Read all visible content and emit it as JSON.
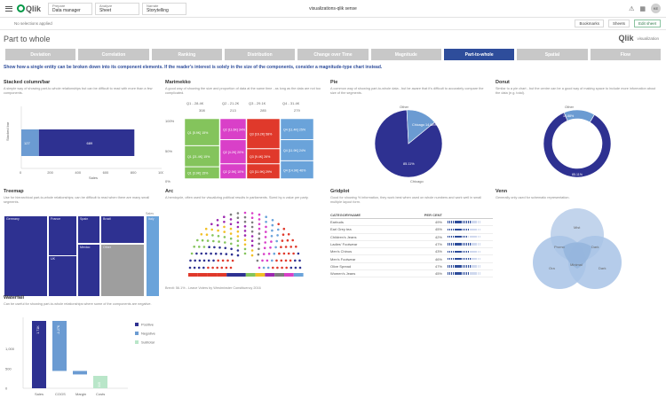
{
  "app": {
    "logo": "Qlik",
    "crumbs": [
      {
        "caption": "Prepare",
        "value": "Data manager"
      },
      {
        "caption": "Analyze",
        "value": "Sheet"
      },
      {
        "caption": "Narrate",
        "value": "Storytelling"
      }
    ],
    "title": "visualizations-qlik sense",
    "avatar": "KE",
    "edit_label": "Edit sheet",
    "bookmarks_label": "Bookmarks",
    "sheets_label": "Sheets",
    "selections_label": "No selections applied"
  },
  "sheet": {
    "title": "Part to whole",
    "brand": "Qlik",
    "brand_sub": "visualization"
  },
  "nav": {
    "items": [
      "Deviation",
      "Correlation",
      "Ranking",
      "Distribution",
      "Change over Time",
      "Magnitude",
      "Part-to-whole",
      "Spatial",
      "Flow"
    ],
    "active": "Part-to-whole"
  },
  "intro": "Show how a single entity can be broken down into its component elements. If the reader's interest is solely in the size of the components, consider a magnitude-type chart instead.",
  "panels": {
    "stacked": {
      "title": "Stacked column/bar",
      "desc": "A simple way of showing part-to-whole relationships but can be difficult to read with more than a few components.",
      "ylabel": "Stacked bar",
      "xlabel": "Sales",
      "left_value": "127",
      "main_value": "689",
      "ticks": [
        "0",
        "200",
        "400",
        "600",
        "800",
        "1000"
      ]
    },
    "marimekko": {
      "title": "Marimekko",
      "desc": "A good way of showing the size and proportion of data at the same time - as long as the data are not too complicated.",
      "col_labels": [
        "Q1 - 28.4K",
        "Q2 - 21.2K",
        "Q3 - 29.1K",
        "Q4 - 31.4K"
      ],
      "col_values": [
        "308",
        "213",
        "285",
        "279"
      ],
      "y_ticks": [
        "100%",
        "50%",
        "0%"
      ],
      "cells": [
        "Q1 [5.9K] 15%",
        "Q1 [21.4K] 15%",
        "Q1 [3.9K] 15%",
        "Q2 [11.6K] 34%",
        "Q2 [4.2K] 20%",
        "Q2 [2.5K] 10%",
        "Q3 [16.2K] 58%",
        "Q3 [9.4K] 26%",
        "Q3 [11.9K] 29%",
        "Q4 [11.4K] 25%",
        "Q4 [11.9K] 24%",
        "Q4 [14.9K] 46%"
      ]
    },
    "pie": {
      "title": "Pie",
      "desc": "A common way of showing part-to-whole data - but be aware that it's difficult to accurately compare the size of the segments.",
      "small_label": "Chicago 14.88%",
      "big_label": "85.11%",
      "legend": [
        "Other",
        "Chicago"
      ]
    },
    "donut": {
      "title": "Donut",
      "desc": "Similar to a pie chart - but the centre can be a good way of making space to include more information about the data (e.g. total).",
      "small_label": "Other",
      "big_label": "85.11%",
      "top_label": "14.88%"
    },
    "treemap": {
      "title": "Treemap",
      "desc": "Use for hierarchical part-to-whole relationships; can be difficult to read when there are many small segments.",
      "header": "Sales",
      "cells": [
        "Germany",
        "France",
        "Spain",
        "Brazil",
        "UK",
        "Mexico",
        "Other",
        "Italy"
      ]
    },
    "arc": {
      "title": "Arc",
      "desc": "A hemicycle, often used for visualizing political results in parliaments. Sized by a value per party.",
      "footer": "Brexit: 56.1% - Leave Voters by Westminster Constituency 2016"
    },
    "gridplot": {
      "title": "Gridplot",
      "desc": "Good for showing % information, they work best when used on whole numbers and work well in small multiple layout form.",
      "head": [
        "CATEGORYNAME",
        "PER CENT"
      ],
      "rows": [
        {
          "name": "Earbuds",
          "value": "49%",
          "fill": 14
        },
        {
          "name": "Earl Grey tea",
          "value": "45%",
          "fill": 13
        },
        {
          "name": "Children's Jeans",
          "value": "42%",
          "fill": 12
        },
        {
          "name": "Ladies' Footwear",
          "value": "47%",
          "fill": 14
        },
        {
          "name": "Men's Chinos",
          "value": "43%",
          "fill": 13
        },
        {
          "name": "Men's Footwear",
          "value": "46%",
          "fill": 14
        },
        {
          "name": "Olive Spread",
          "value": "47%",
          "fill": 14
        },
        {
          "name": "Women's Jeans",
          "value": "45%",
          "fill": 13
        }
      ]
    },
    "venn": {
      "title": "Venn",
      "desc": "Generally only used for schematic representation.",
      "labels": [
        "Mist",
        "Promo",
        "Dark",
        "Ora",
        "Minimal",
        "Dark"
      ]
    },
    "waterfall": {
      "title": "Waterfall",
      "desc": "Can be useful for showing part-to-whole relationships where some of the components are negative.",
      "y_ticks": [
        "0",
        "500",
        "1,000"
      ],
      "legend": [
        "Positive",
        "Negative",
        "Subtotal"
      ],
      "categories": [
        "Sales",
        "COGS",
        "Margin",
        "Costs"
      ],
      "labels": [
        "1.71K",
        "-1.27K",
        "-89",
        "315"
      ]
    }
  },
  "chart_data": [
    {
      "type": "bar",
      "title": "Stacked column/bar",
      "xlabel": "Sales",
      "ylabel": "Stacked bar",
      "series": [
        {
          "name": "",
          "values": [
            127
          ]
        },
        {
          "name": "",
          "values": [
            689
          ]
        }
      ],
      "xlim": [
        0,
        1000
      ]
    },
    {
      "type": "pie",
      "title": "Pie",
      "values": [
        85.11,
        14.88
      ],
      "labels": [
        "Other",
        "Chicago"
      ]
    },
    {
      "type": "pie",
      "title": "Donut",
      "values": [
        85.11,
        14.88
      ],
      "labels": [
        "",
        "Other"
      ]
    },
    {
      "type": "bar",
      "title": "Waterfall",
      "categories": [
        "Sales",
        "COGS",
        "Margin",
        "Costs"
      ],
      "values": [
        1710,
        -1270,
        -89,
        315
      ],
      "ylim": [
        0,
        1800
      ]
    }
  ],
  "colors": {
    "primary": "#2e3191",
    "secondary": "#6b9bd2",
    "nav_active": "#2e4d9b",
    "nav": "#c8c8c8",
    "green": "#84c45c",
    "magenta": "#d940c8",
    "red": "#e0392b",
    "blue_light": "#6aa3da"
  }
}
